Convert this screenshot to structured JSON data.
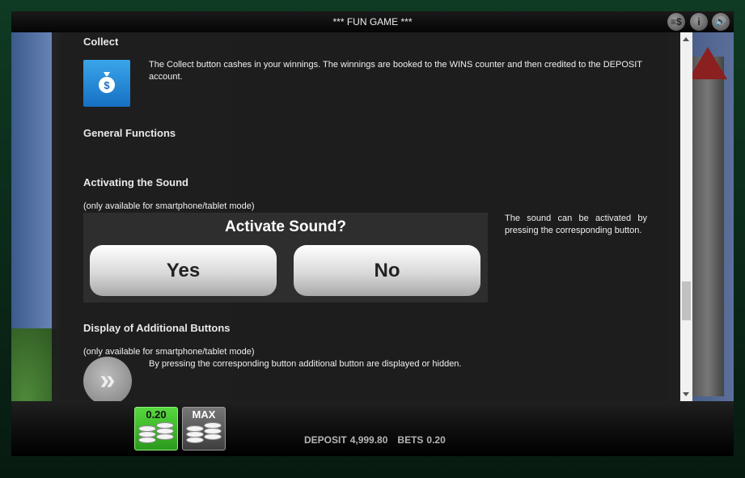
{
  "window": {
    "title": "*** FUN GAME ***",
    "icons": [
      "paytable-icon",
      "info-icon",
      "sound-icon"
    ],
    "icon_glyphs": [
      "≡$",
      "i",
      "🔊"
    ]
  },
  "help": {
    "collect": {
      "heading": "Collect",
      "text": "The Collect button cashes in your winnings. The winnings are booked to the WINS counter and then credited to the DEPOSIT account."
    },
    "general": {
      "heading": "General Functions"
    },
    "sound": {
      "heading": "Activating the Sound",
      "note": "(only available for smartphone/tablet mode)",
      "dialog_title": "Activate Sound?",
      "yes_label": "Yes",
      "no_label": "No",
      "text": "The sound can be activated by pressing the corresponding button."
    },
    "additional": {
      "heading": "Display of Additional Buttons",
      "note": "(only available for smartphone/tablet mode)",
      "text": "By pressing the corresponding button additional button are displayed or hidden.",
      "icon_glyph": "»"
    }
  },
  "bottom": {
    "bet_button_label": "0.20",
    "max_button_label": "MAX",
    "deposit_label": "DEPOSIT",
    "deposit_value": "4,999.80",
    "bets_label": "BETS",
    "bets_value": "0.20"
  },
  "colors": {
    "bet_button": "#3fbf2a",
    "max_button": "#5a5a5a",
    "collect_icon": "#1e86d8"
  }
}
